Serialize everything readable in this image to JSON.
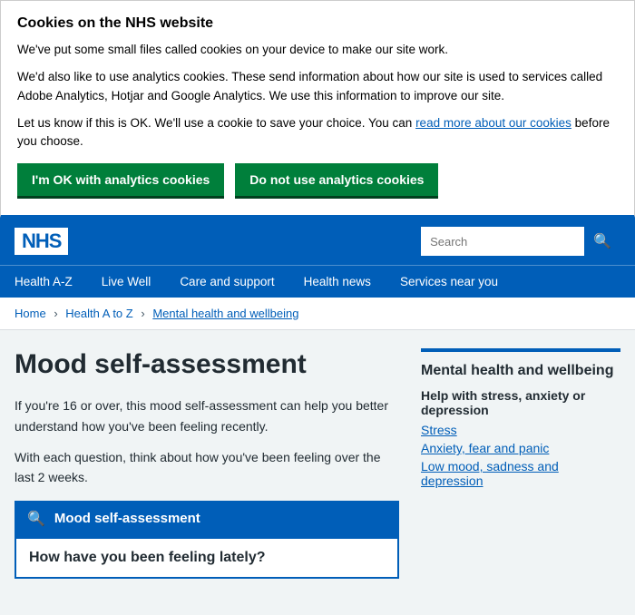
{
  "cookie_banner": {
    "title": "Cookies on the NHS website",
    "para1": "We've put some small files called cookies on your device to make our site work.",
    "para2": "We'd also like to use analytics cookies. These send information about how our site is used to services called Adobe Analytics, Hotjar and Google Analytics. We use this information to improve our site.",
    "para3_before": "Let us know if this is OK. We'll use a cookie to save your choice. You can ",
    "para3_link": "read more about our cookies",
    "para3_after": " before you choose.",
    "btn_accept": "I'm OK with analytics cookies",
    "btn_decline": "Do not use analytics cookies"
  },
  "header": {
    "logo": "NHS",
    "search_placeholder": "Search"
  },
  "nav": {
    "items": [
      {
        "label": "Health A-Z"
      },
      {
        "label": "Live Well"
      },
      {
        "label": "Care and support"
      },
      {
        "label": "Health news"
      },
      {
        "label": "Services near you"
      }
    ]
  },
  "breadcrumb": {
    "items": [
      {
        "label": "Home"
      },
      {
        "label": "Health A to Z"
      },
      {
        "label": "Mental health and wellbeing"
      }
    ]
  },
  "main": {
    "page_title": "Mood self-assessment",
    "intro1": "If you're 16 or over, this mood self-assessment can help you better understand how you've been feeling recently.",
    "intro2": "With each question, think about how you've been feeling over the last 2 weeks.",
    "tool_label": "Mood self-assessment",
    "question": "How have you been feeling lately?"
  },
  "sidebar": {
    "heading": "Mental health and wellbeing",
    "sub_heading": "Help with stress, anxiety or depression",
    "links": [
      {
        "label": "Stress"
      },
      {
        "label": "Anxiety, fear and panic"
      },
      {
        "label": "Low mood, sadness and depression"
      }
    ]
  }
}
